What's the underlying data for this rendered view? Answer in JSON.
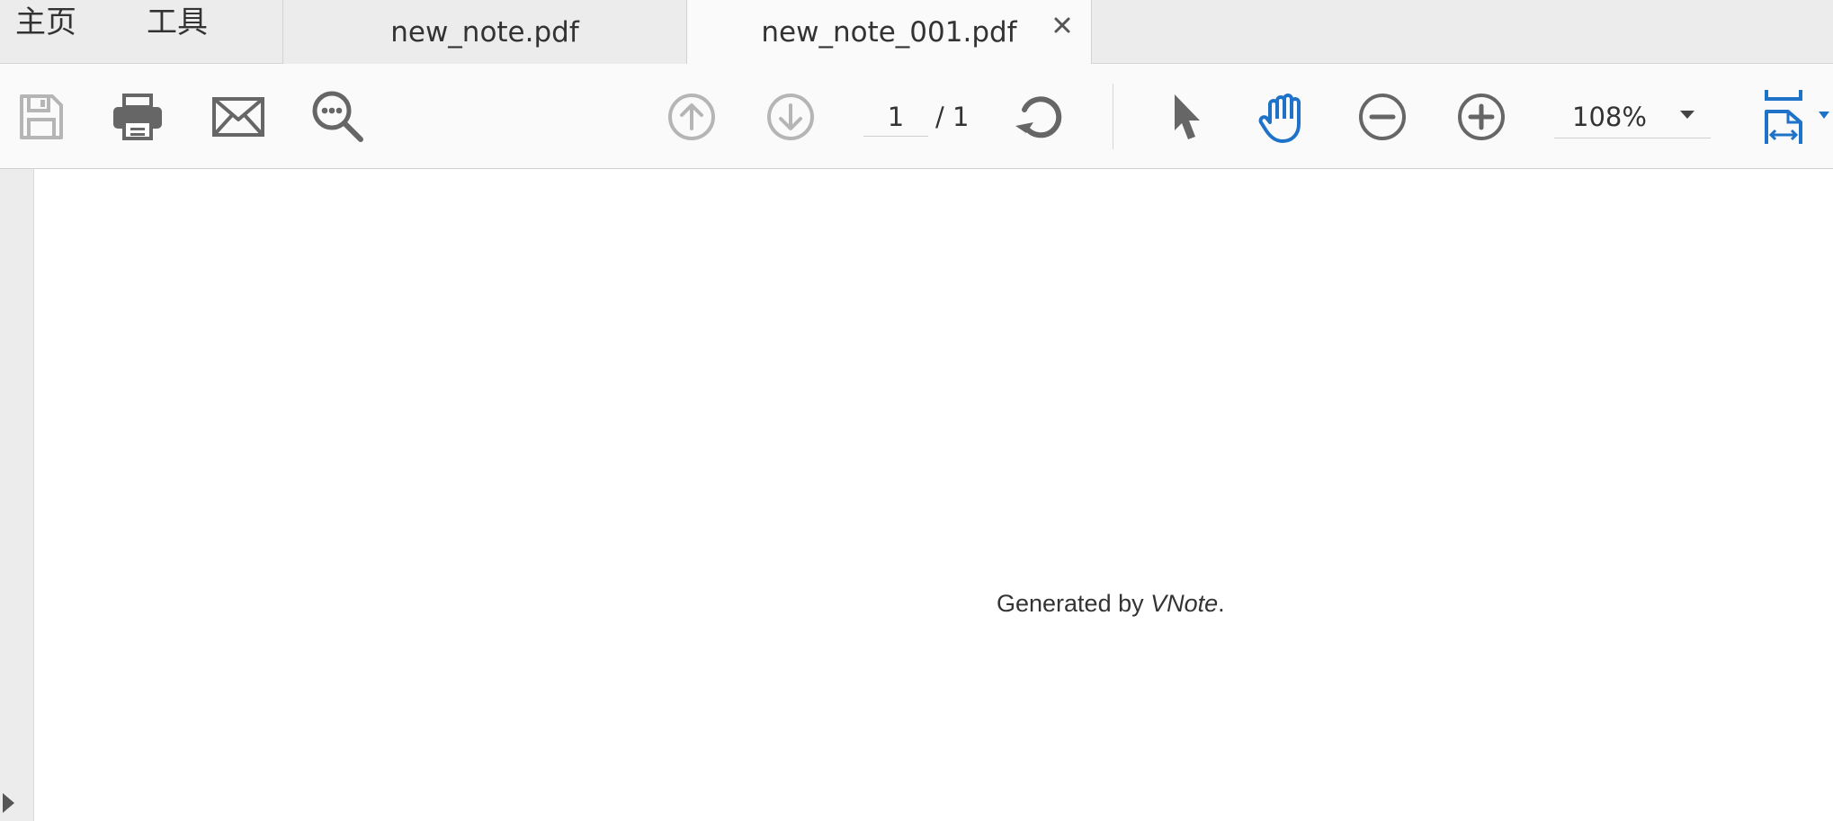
{
  "nav": {
    "home_label": "主页",
    "tools_label": "工具"
  },
  "tabs": [
    {
      "label": "new_note.pdf",
      "active": false
    },
    {
      "label": "new_note_001.pdf",
      "active": true
    }
  ],
  "toolbar": {
    "icons": [
      "save-icon",
      "print-icon",
      "email-icon",
      "search-icon",
      "page-up-icon",
      "page-down-icon",
      "rotate-icon",
      "select-arrow-icon",
      "hand-tool-icon",
      "zoom-out-icon",
      "zoom-in-icon",
      "fit-page-icon"
    ],
    "current_page": "1",
    "page_total": "/ 1",
    "zoom": "108%"
  },
  "document": {
    "text_prefix": "Generated by ",
    "text_brand": "VNote",
    "text_suffix": "."
  },
  "colors": {
    "accent": "#1e73c8",
    "icon_dark": "#666666",
    "icon_disabled": "#b5b5b5",
    "tabbar_bg": "#ececec",
    "toolbar_bg": "#fafafa"
  }
}
